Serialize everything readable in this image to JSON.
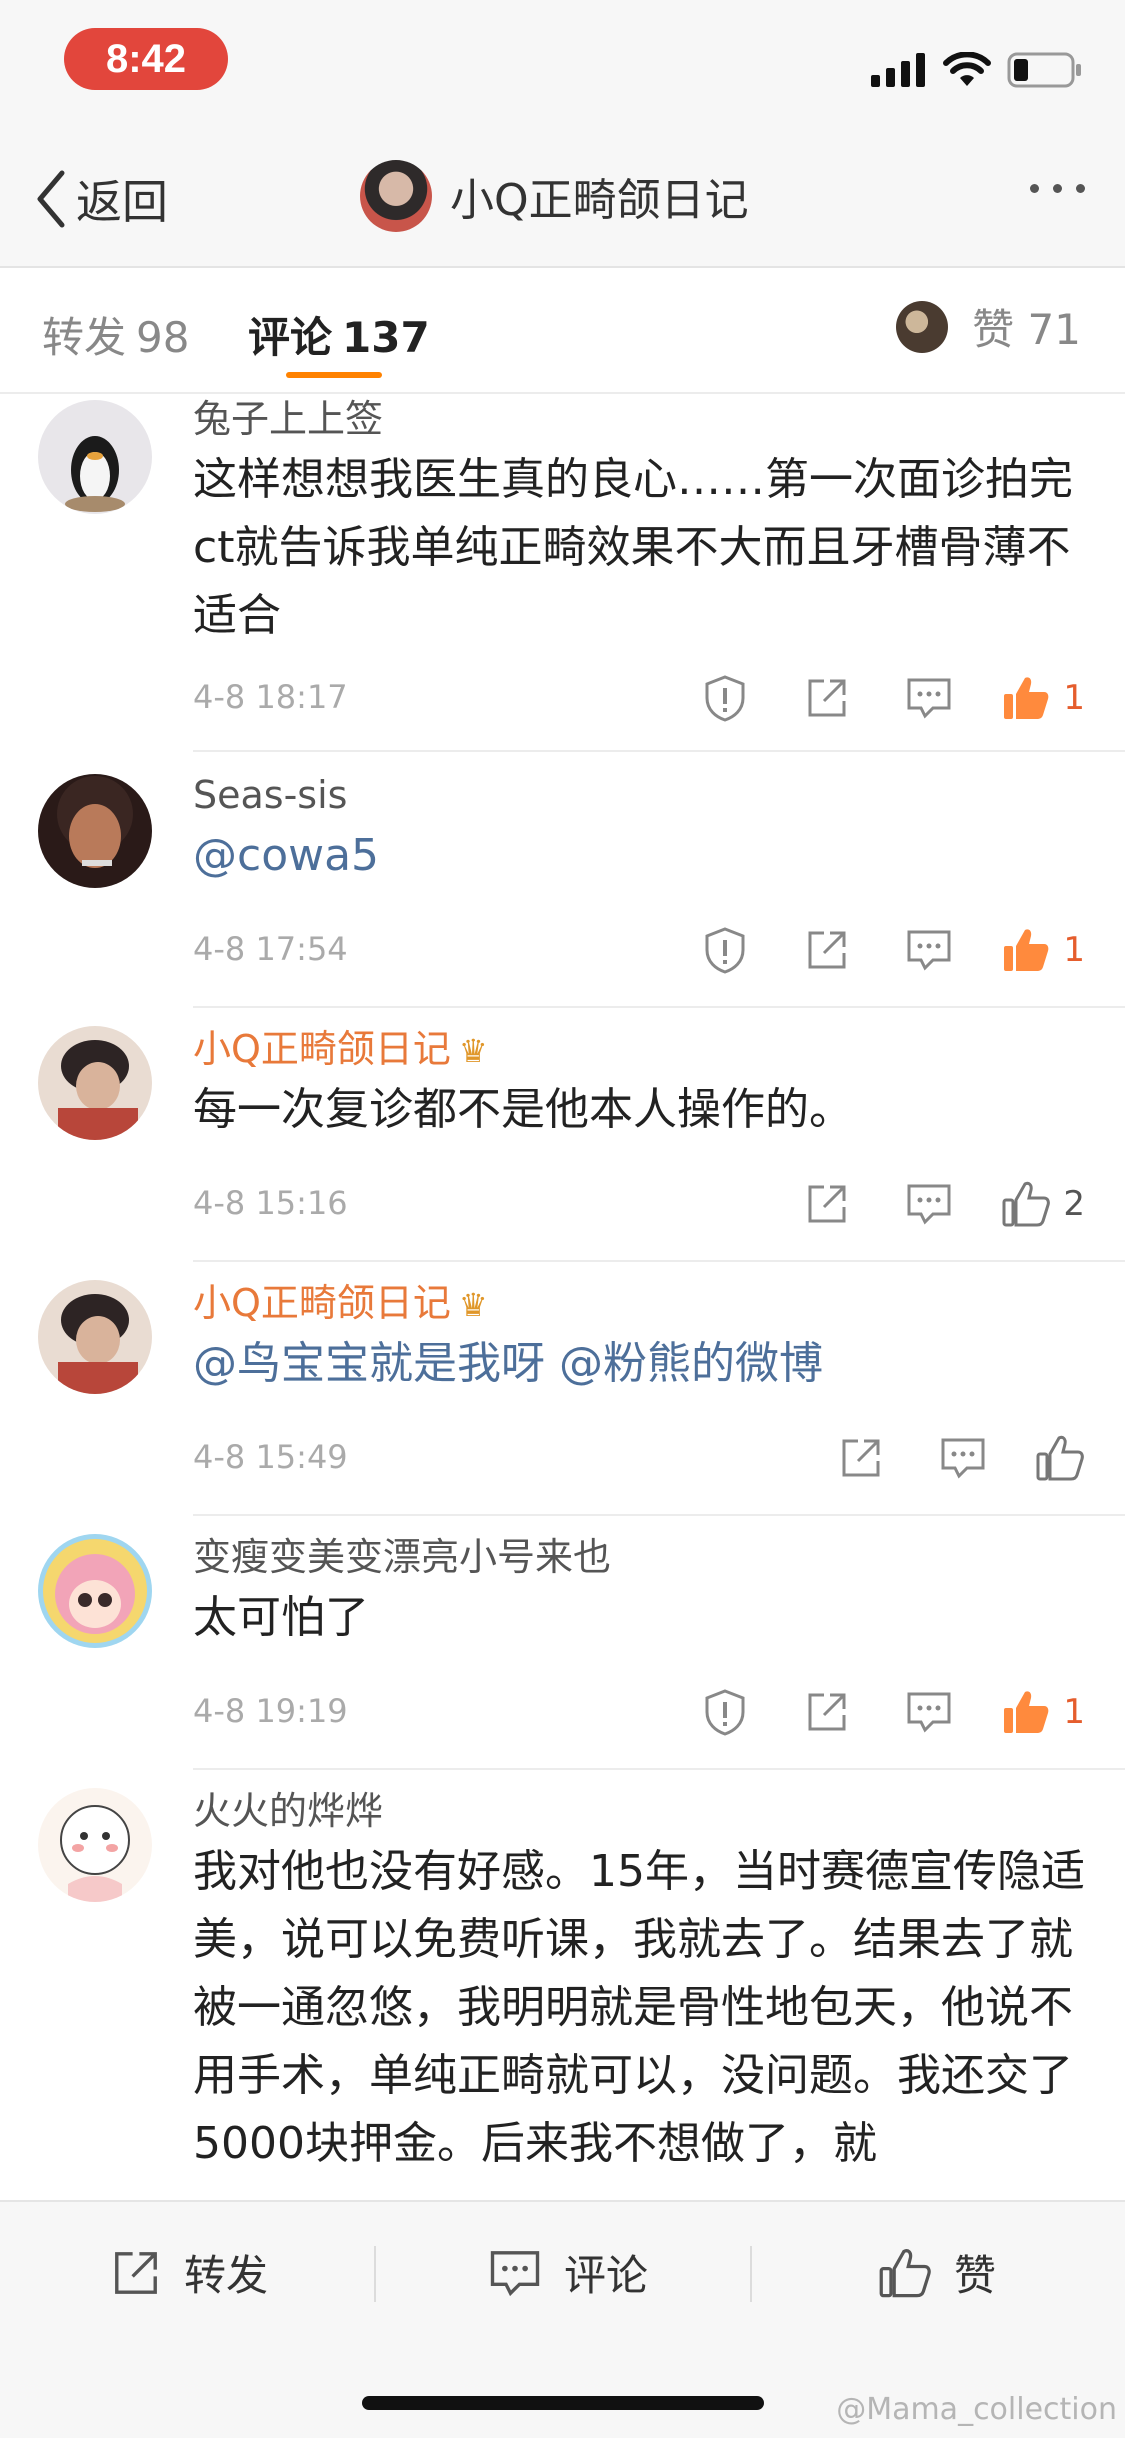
{
  "status": {
    "time": "8:42"
  },
  "nav": {
    "back_label": "返回",
    "title": "小Q正畸颌日记",
    "more_icon": "more-dots-icon"
  },
  "tabs": {
    "repost": {
      "label": "转发",
      "count": "98"
    },
    "comments": {
      "label": "评论",
      "count": "137"
    },
    "likes": {
      "label": "赞",
      "count": "71"
    }
  },
  "comments": [
    {
      "name": "兔子上上签",
      "owner": false,
      "text": "这样想想我医生真的良心……第一次面诊拍完ct就告诉我单纯正畸效果不大而且牙槽骨薄不适合",
      "time": "4-8 18:17",
      "likes": "1",
      "liked": true,
      "report": true
    },
    {
      "name": "Seas-sis",
      "owner": false,
      "text": "@cowa5",
      "time": "4-8 17:54",
      "likes": "1",
      "liked": true,
      "report": true
    },
    {
      "name": "小Q正畸颌日记",
      "owner": true,
      "text": "每一次复诊都不是他本人操作的。",
      "time": "4-8 15:16",
      "likes": "2",
      "liked": false,
      "report": false
    },
    {
      "name": "小Q正畸颌日记",
      "owner": true,
      "text": "@鸟宝宝就是我呀 @粉熊的微博",
      "time": "4-8 15:49",
      "likes": "",
      "liked": false,
      "report": false
    },
    {
      "name": "变瘦变美变漂亮小号来也",
      "owner": false,
      "text": "太可怕了",
      "time": "4-8 19:19",
      "likes": "1",
      "liked": true,
      "report": true
    },
    {
      "name": "火火的烨烨",
      "owner": false,
      "text": "我对他也没有好感。15年，当时赛德宣传隐适美，说可以免费听课，我就去了。结果去了就被一通忽悠，我明明就是骨性地包天，他说不用手术，单纯正畸就可以，没问题。我还交了5000块押金。后来我不想做了，就",
      "time": "",
      "likes": "",
      "liked": false,
      "report": false
    }
  ],
  "bottom": {
    "repost": "转发",
    "comment": "评论",
    "like": "赞"
  },
  "watermark": "@Mama_collection",
  "colors": {
    "accent": "#ff8200",
    "liked": "#e55d2d",
    "mention": "#4d6f9a",
    "owner_name": "#e8793a",
    "time_pill": "#e2463c"
  }
}
